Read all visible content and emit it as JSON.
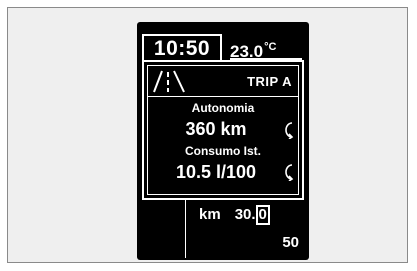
{
  "clock": "10:50",
  "temperature": {
    "value": "23.0",
    "unit": "°C"
  },
  "trip_label": "TRIP A",
  "range": {
    "label": "Autonomia",
    "value": "360 km"
  },
  "consumption": {
    "label": "Consumo Ist.",
    "value": "10.5 l/100"
  },
  "odometer": {
    "unit": "km",
    "value_main": "30.",
    "value_last_digit": "0"
  },
  "lower_value": "50",
  "icons": [
    "road-icon",
    "cycle-icon"
  ]
}
